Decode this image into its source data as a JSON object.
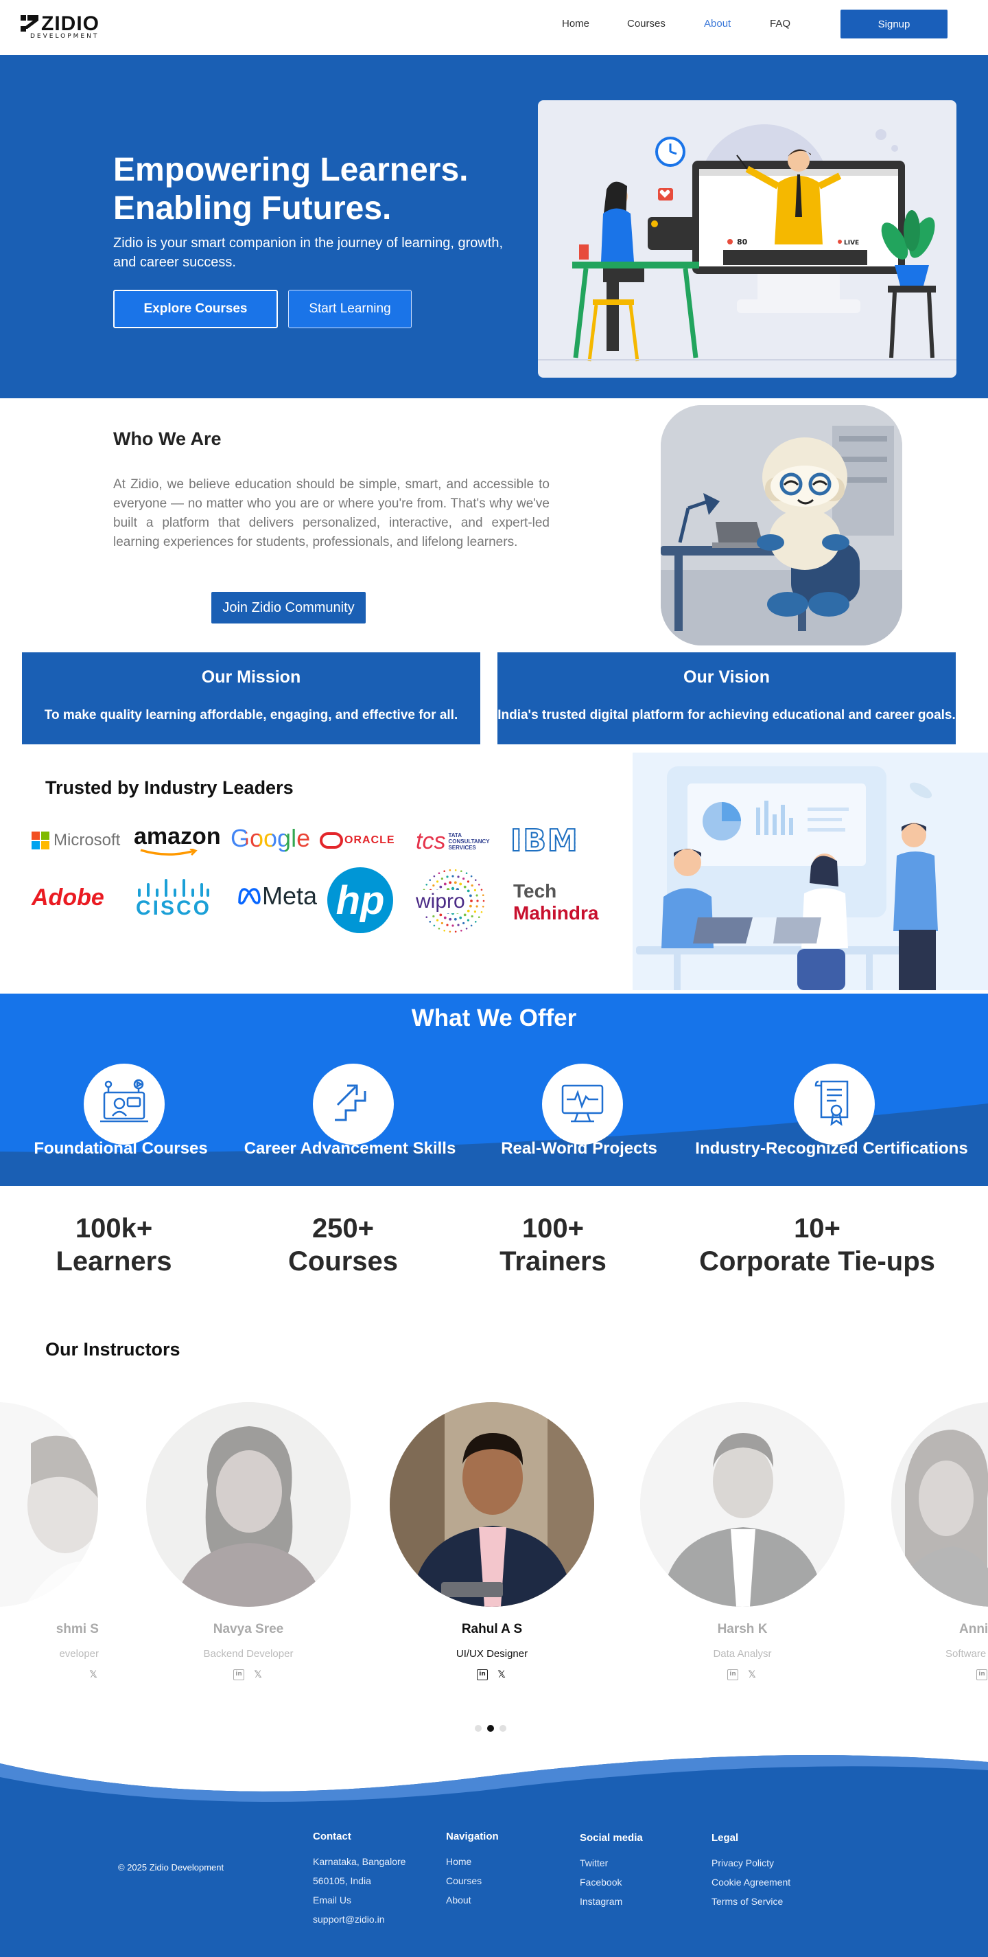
{
  "nav": {
    "logo_text": "ZIDIO",
    "logo_sub": "DEVELOPMENT",
    "links": [
      "Home",
      "Courses",
      "About",
      "FAQ"
    ],
    "active_link": "About",
    "signup": "Signup"
  },
  "hero": {
    "title_line1": "Empowering Learners.",
    "title_line2": "Enabling Futures.",
    "subtitle": "Zidio is your smart companion in the journey of learning, growth, and career success.",
    "btn_explore": "Explore Courses",
    "btn_start": "Start Learning",
    "illus_count": "80",
    "illus_live": "LIVE"
  },
  "who": {
    "title": "Who We Are",
    "text": "At Zidio, we believe education should be simple, smart, and accessible to everyone — no matter who you are or where you're from. That's why we've built a platform that delivers personalized, interactive, and expert-led learning experiences for students, professionals, and lifelong learners.",
    "button": "Join Zidio Community"
  },
  "mission": {
    "title": "Our Mission",
    "text": "To make quality learning affordable, engaging, and effective for all."
  },
  "vision": {
    "title": "Our Vision",
    "text": "India's trusted digital platform for achieving educational and career goals."
  },
  "trusted": {
    "title": "Trusted by Industry Leaders",
    "logos": [
      "Microsoft",
      "amazon",
      "Google",
      "ORACLE",
      "tcs",
      "TATA CONSULTANCY SERVICES",
      "IBM",
      "Adobe",
      "CISCO",
      "Meta",
      "hp",
      "wipro",
      "Tech",
      "Mahindra"
    ]
  },
  "offer": {
    "title": "What We Offer",
    "items": [
      {
        "label": "Foundational Courses",
        "icon": "online-course-icon"
      },
      {
        "label": "Career Advancement Skills",
        "icon": "stairs-arrow-icon"
      },
      {
        "label": "Real-World Projects",
        "icon": "monitor-pulse-icon"
      },
      {
        "label": "Industry-Recognized Certifications",
        "icon": "certificate-icon"
      }
    ]
  },
  "stats": [
    {
      "value": "100k+",
      "label": "Learners"
    },
    {
      "value": "250+",
      "label": "Courses"
    },
    {
      "value": "100+",
      "label": "Trainers"
    },
    {
      "value": "10+",
      "label": "Corporate Tie-ups"
    }
  ],
  "instructors": {
    "title": "Our Instructors",
    "items": [
      {
        "name": "shmi S",
        "role": "eveloper"
      },
      {
        "name": "Navya Sree",
        "role": "Backend Developer"
      },
      {
        "name": "Rahul A S",
        "role": "UI/UX Designer"
      },
      {
        "name": "Harsh K",
        "role": "Data Analysr"
      },
      {
        "name": "Anni",
        "role": "Software"
      }
    ],
    "active_index": 2,
    "carousel_dots": 3,
    "active_dot": 1
  },
  "footer": {
    "copyright": "© 2025 Zidio Development",
    "contact": {
      "title": "Contact",
      "lines": [
        "Karnataka, Bangalore",
        "560105, India",
        "Email Us",
        "support@zidio.in"
      ]
    },
    "navigation": {
      "title": "Navigation",
      "lines": [
        "Home",
        "Courses",
        "About"
      ]
    },
    "social": {
      "title": "Social media",
      "lines": [
        "Twitter",
        "Facebook",
        "Instagram"
      ]
    },
    "legal": {
      "title": "Legal",
      "lines": [
        "Privacy Policty",
        "Cookie Agreement",
        "Terms of Service"
      ]
    }
  },
  "colors": {
    "primary": "#1a5fb4",
    "bright_blue": "#1674ea",
    "link_active": "#3b78d8"
  }
}
